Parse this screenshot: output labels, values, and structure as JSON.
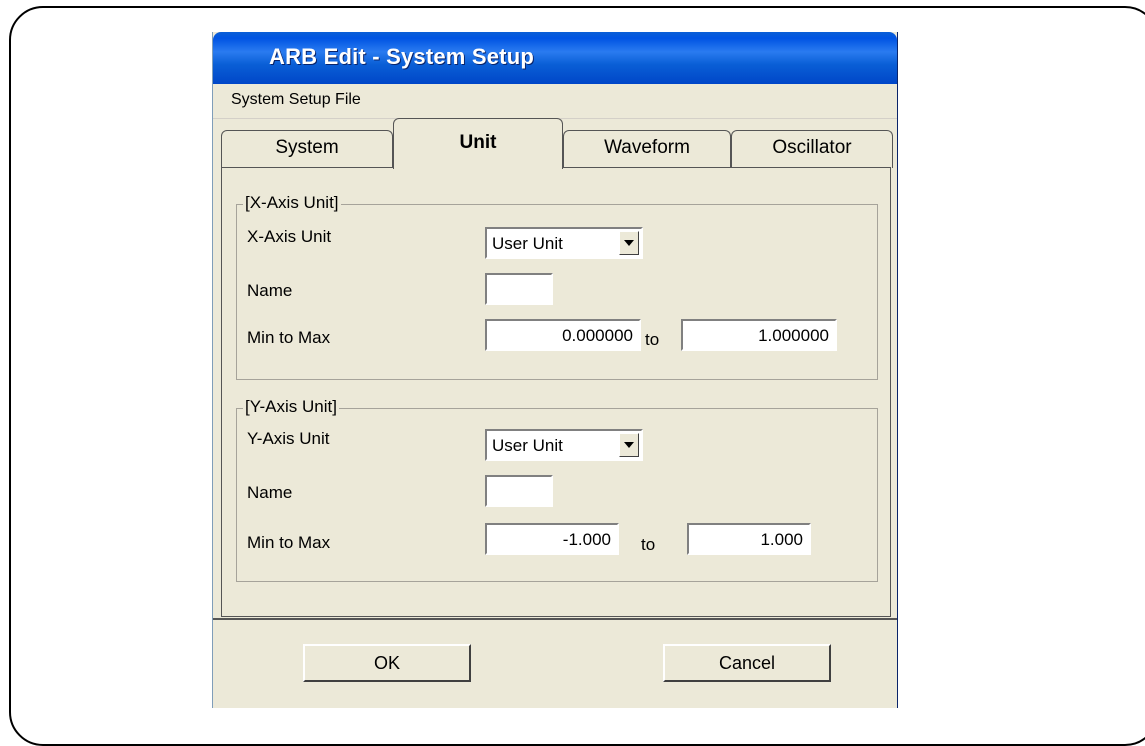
{
  "window": {
    "title": "ARB Edit - System Setup"
  },
  "menu": {
    "label": "System Setup File"
  },
  "tabs": [
    {
      "label": "System",
      "active": false
    },
    {
      "label": "Unit",
      "active": true
    },
    {
      "label": "Waveform",
      "active": false
    },
    {
      "label": "Oscillator",
      "active": false
    }
  ],
  "x_axis": {
    "group_label": "[X-Axis Unit]",
    "unit_label": "X-Axis Unit",
    "unit_value": "User Unit",
    "name_label": "Name",
    "name_value": "",
    "range_label": "Min to Max",
    "min_value": "0.000000",
    "to_label": "to",
    "max_value": "1.000000"
  },
  "y_axis": {
    "group_label": "[Y-Axis Unit]",
    "unit_label": "Y-Axis Unit",
    "unit_value": "User Unit",
    "name_label": "Name",
    "name_value": "",
    "range_label": "Min to Max",
    "min_value": "-1.000",
    "to_label": "to",
    "max_value": "1.000"
  },
  "buttons": {
    "ok": "OK",
    "cancel": "Cancel"
  }
}
